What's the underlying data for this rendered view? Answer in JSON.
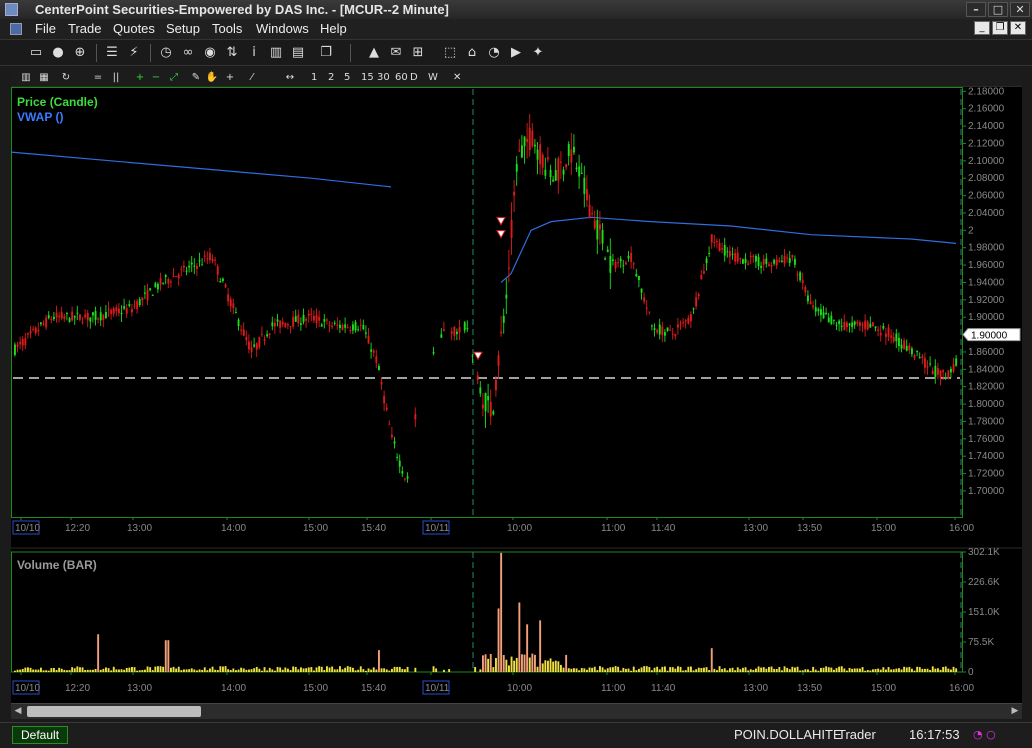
{
  "window": {
    "title": "CenterPoint Securities-Empowered by DAS Inc. - [MCUR--2 Minute]",
    "buttons": [
      "–",
      "□",
      "✕"
    ]
  },
  "menu": {
    "items": [
      {
        "label": "File"
      },
      {
        "label": "Trade"
      },
      {
        "label": "Quotes"
      },
      {
        "label": "Setup"
      },
      {
        "label": "Tools"
      },
      {
        "label": "Windows"
      },
      {
        "label": "Help"
      }
    ],
    "mdi_buttons": [
      "_",
      "❐",
      "✕"
    ]
  },
  "toolbar": {
    "icons": [
      {
        "name": "window-icon",
        "glyph": "▭"
      },
      {
        "name": "user-icon",
        "glyph": "●"
      },
      {
        "name": "currency-icon",
        "glyph": "⊕"
      },
      {
        "name": "list-icon",
        "glyph": "☰"
      },
      {
        "name": "lightning-icon",
        "glyph": "⚡"
      },
      {
        "name": "clock-icon",
        "glyph": "◷"
      },
      {
        "name": "link-icon",
        "glyph": "∞"
      },
      {
        "name": "eye-icon",
        "glyph": "◉"
      },
      {
        "name": "sort-icon",
        "glyph": "⇅"
      },
      {
        "name": "info-icon",
        "glyph": "i"
      },
      {
        "name": "bar-chart-icon",
        "glyph": "▥"
      },
      {
        "name": "document-icon",
        "glyph": "▤"
      },
      {
        "name": "copy-icon",
        "glyph": "❐"
      },
      {
        "name": "alert-icon",
        "glyph": "▲"
      },
      {
        "name": "mail-icon",
        "glyph": "✉"
      },
      {
        "name": "network-icon",
        "glyph": "⊞"
      },
      {
        "name": "select-icon",
        "glyph": "⬚"
      },
      {
        "name": "home-icon",
        "glyph": "⌂"
      },
      {
        "name": "timer-icon",
        "glyph": "◔"
      },
      {
        "name": "video-icon",
        "glyph": "▶"
      },
      {
        "name": "twitter-icon",
        "glyph": "✦"
      }
    ]
  },
  "chart_toolbar": {
    "tools": [
      {
        "name": "summary-icon",
        "label": "▥"
      },
      {
        "name": "bar-style-icon",
        "label": "▦"
      },
      {
        "name": "refresh-icon",
        "label": "↻"
      },
      {
        "name": "horizontal-line-icon",
        "label": "="
      },
      {
        "name": "vertical-line-icon",
        "label": "||"
      },
      {
        "name": "zoom-in-icon",
        "label": "+"
      },
      {
        "name": "zoom-out-icon",
        "label": "−"
      },
      {
        "name": "fit-icon",
        "label": "⤢"
      },
      {
        "name": "pencil-icon",
        "label": "✎"
      },
      {
        "name": "hand-icon",
        "label": "✋"
      },
      {
        "name": "crosshair-icon",
        "label": "+"
      },
      {
        "name": "draw-line-icon",
        "label": "⁄"
      },
      {
        "name": "pan-icon",
        "label": "↔"
      }
    ],
    "timeframes": [
      "1",
      "2",
      "5",
      "15",
      "30",
      "60",
      "D",
      "W"
    ],
    "close": "✕"
  },
  "chart": {
    "price_label": "Price (Candle)",
    "vwap_label": "VWAP ()",
    "volume_label": "Volume (BAR)",
    "current_price": "1.90000",
    "colors": {
      "up": "#19e019",
      "down": "#e01919",
      "vwap": "#2f6de0",
      "volume": "#f0e040",
      "axis": "#1e8a1e",
      "axis_text": "#8a8a8a",
      "session_line": "#1f8c6c",
      "price_label": "#3ddc3d",
      "vwap_label": "#3a7bff"
    },
    "time_labels": [
      "10/10",
      "12:20",
      "13:00",
      "14:00",
      "15:00",
      "15:40",
      "10/11",
      "10:00",
      "11:00",
      "11:40",
      "13:00",
      "13:50",
      "15:00",
      "16:00"
    ]
  },
  "chart_data": [
    {
      "type": "candlestick",
      "title": "Price (Candle)",
      "ylim": [
        1.69,
        2.185
      ],
      "y_ticks": [
        "2.18000",
        "2.16000",
        "2.14000",
        "2.12000",
        "2.10000",
        "2.08000",
        "2.06000",
        "2.04000",
        "2",
        "1.98000",
        "1.96000",
        "1.94000",
        "1.92000",
        "1.90000",
        "1.88000",
        "1.86000",
        "1.84000",
        "1.82000",
        "1.80000",
        "1.78000",
        "1.76000",
        "1.74000",
        "1.72000",
        "1.70000"
      ],
      "reference_line": 1.85,
      "vwap": {
        "name": "VWAP ()",
        "session1": [
          [
            0,
            2.11
          ],
          [
            100,
            2.1
          ],
          [
            200,
            2.09
          ],
          [
            300,
            2.08
          ],
          [
            380,
            2.07
          ]
        ],
        "session2": [
          [
            490,
            1.96
          ],
          [
            500,
            1.97
          ],
          [
            520,
            2.02
          ],
          [
            540,
            2.03
          ],
          [
            580,
            2.035
          ],
          [
            640,
            2.03
          ],
          [
            720,
            2.025
          ],
          [
            800,
            2.015
          ],
          [
            900,
            2.01
          ],
          [
            945,
            2.005
          ]
        ]
      },
      "price_path": [
        [
          0,
          1.88
        ],
        [
          40,
          1.92
        ],
        [
          80,
          1.92
        ],
        [
          120,
          1.93
        ],
        [
          150,
          1.96
        ],
        [
          200,
          1.99
        ],
        [
          225,
          1.92
        ],
        [
          240,
          1.88
        ],
        [
          260,
          1.91
        ],
        [
          300,
          1.92
        ],
        [
          320,
          1.91
        ],
        [
          350,
          1.91
        ],
        [
          365,
          1.87
        ],
        [
          380,
          1.78
        ],
        [
          395,
          1.73
        ],
        [
          410,
          1.86
        ],
        [
          430,
          1.9
        ],
        [
          455,
          1.91
        ],
        [
          470,
          1.83
        ],
        [
          480,
          1.81
        ],
        [
          495,
          1.95
        ],
        [
          505,
          2.1
        ],
        [
          520,
          2.13
        ],
        [
          540,
          2.08
        ],
        [
          560,
          2.11
        ],
        [
          580,
          2.04
        ],
        [
          600,
          1.98
        ],
        [
          620,
          1.99
        ],
        [
          640,
          1.91
        ],
        [
          660,
          1.9
        ],
        [
          680,
          1.92
        ],
        [
          700,
          2.01
        ],
        [
          720,
          1.99
        ],
        [
          760,
          1.98
        ],
        [
          780,
          1.99
        ],
        [
          800,
          1.93
        ],
        [
          830,
          1.91
        ],
        [
          860,
          1.91
        ],
        [
          880,
          1.9
        ],
        [
          900,
          1.88
        ],
        [
          920,
          1.86
        ],
        [
          935,
          1.85
        ],
        [
          945,
          1.87
        ]
      ],
      "markers": [
        {
          "x": 490,
          "y": 2.03,
          "type": "sell"
        },
        {
          "x": 490,
          "y": 2.015,
          "type": "sell"
        },
        {
          "x": 467,
          "y": 1.875,
          "type": "sell"
        }
      ]
    },
    {
      "type": "bar",
      "title": "Volume (BAR)",
      "ylim": [
        0,
        302100
      ],
      "y_ticks": [
        "302.1K",
        "226.6K",
        "151.0K",
        "75.5K",
        "0"
      ],
      "spikes": [
        {
          "x": 86,
          "value": 95000
        },
        {
          "x": 155,
          "value": 80000
        },
        {
          "x": 366,
          "value": 55000
        },
        {
          "x": 466,
          "value": 45000
        },
        {
          "x": 488,
          "value": 160000
        },
        {
          "x": 490,
          "value": 300000
        },
        {
          "x": 508,
          "value": 175000
        },
        {
          "x": 515,
          "value": 120000
        },
        {
          "x": 528,
          "value": 130000
        },
        {
          "x": 700,
          "value": 60000
        }
      ]
    }
  ],
  "status": {
    "tab": "Default",
    "user": "POIN.DOLLAHITE",
    "role": "Trader",
    "time": "16:17:53"
  }
}
